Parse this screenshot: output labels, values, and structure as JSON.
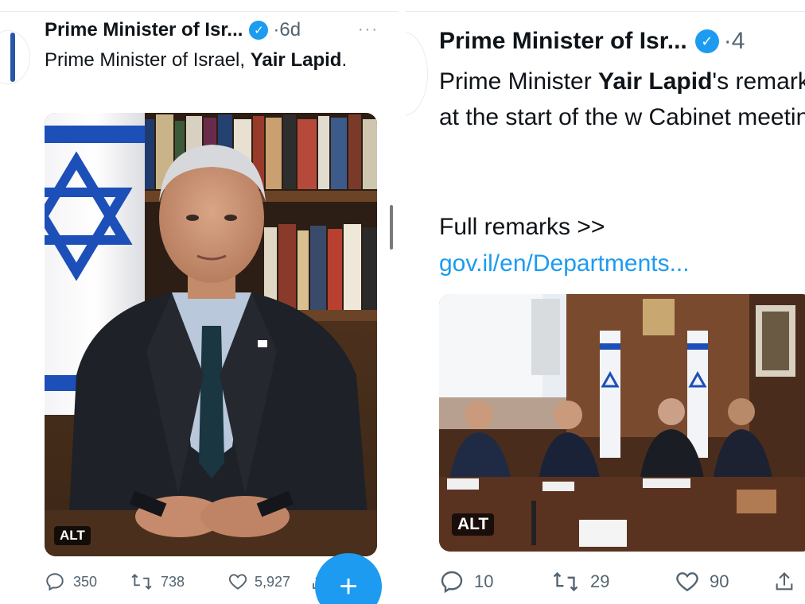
{
  "left_tweet": {
    "author": "Prime Minister of Isr...",
    "time": "6d",
    "more": "···",
    "text_plain": "Prime Minister of Israel, ",
    "text_bold": "Yair Lapid",
    "text_end": ".",
    "alt_label": "ALT",
    "replies": "350",
    "retweets": "738",
    "likes": "5,927",
    "fab_label": "+"
  },
  "right_tweet": {
    "author": "Prime Minister of Isr...",
    "time": "4",
    "text_pre": "Prime Minister ",
    "text_bold": "Yair Lapid",
    "text_post": "'s remarks at the start of the w Cabinet meeting.",
    "full_remarks": "Full remarks >>",
    "link": "gov.il/en/Departments...",
    "alt_label": "ALT",
    "replies": "10",
    "retweets": "29",
    "likes": "90"
  },
  "colors": {
    "accent": "#1d9bf0",
    "text": "#0f1419",
    "muted": "#536471",
    "flag_blue": "#1c4fb8"
  },
  "icons": [
    "verified-icon",
    "reply-icon",
    "retweet-icon",
    "like-icon",
    "share-icon",
    "plus-icon",
    "more-icon"
  ]
}
